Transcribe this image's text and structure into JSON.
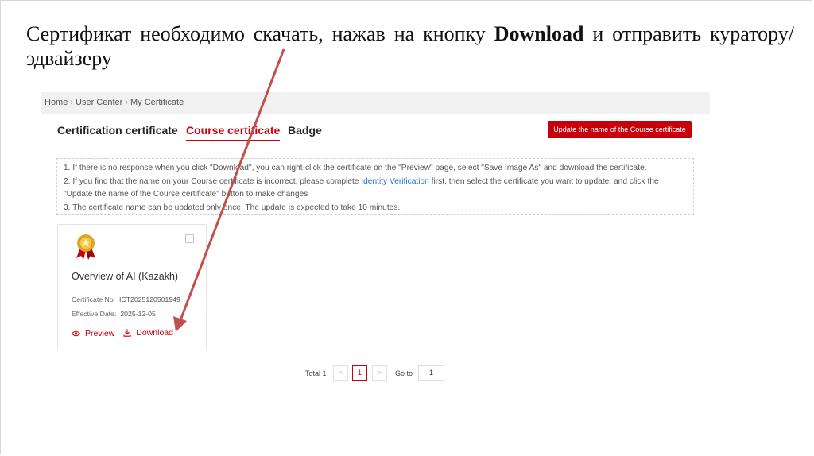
{
  "slide": {
    "title_before": "Сертификат необходимо скачать, нажав на кнопку ",
    "title_bold": "Download",
    "title_after": " и отправить куратору/эдвайзеру"
  },
  "breadcrumb": [
    "Home",
    "User Center",
    "My Certificate"
  ],
  "tabs": [
    {
      "label": "Certification certificate",
      "active": false
    },
    {
      "label": "Course certificate",
      "active": true
    },
    {
      "label": "Badge",
      "active": false
    }
  ],
  "update_button": "Update the name of the Course certificate",
  "notice": {
    "line1": "1. If there is no response when you click \"Download\", you can right-click the certificate on the \"Preview\" page, select \"Save Image As\" and download the certificate.",
    "line2_before": "2. If you find that the name on your Course certificate is incorrect, please complete ",
    "line2_link": "Identity Verification",
    "line2_after": " first, then select the certificate you want to update, and click the \"Update the name of the Course certificate\" button to make changes",
    "line3": "3. The certificate name can be updated only once. The update is expected to take 10 minutes."
  },
  "certificate": {
    "title": "Overview of AI (Kazakh)",
    "number_label": "Certificate No:",
    "number_value": "ICT2025120501949",
    "date_label": "Effective Date:",
    "date_value": "2025-12-05",
    "preview_label": "Preview",
    "download_label": "Download",
    "icons": [
      "medal-icon",
      "eye-icon",
      "download-icon"
    ]
  },
  "pagination": {
    "total_label": "Total",
    "total_value": "1",
    "prev": "<",
    "current_page": "1",
    "next": ">",
    "goto_label": "Go to",
    "goto_value": "1"
  },
  "colors": {
    "accent": "#c7000b",
    "link": "#1c73c9",
    "arrow": "#c0504d"
  }
}
